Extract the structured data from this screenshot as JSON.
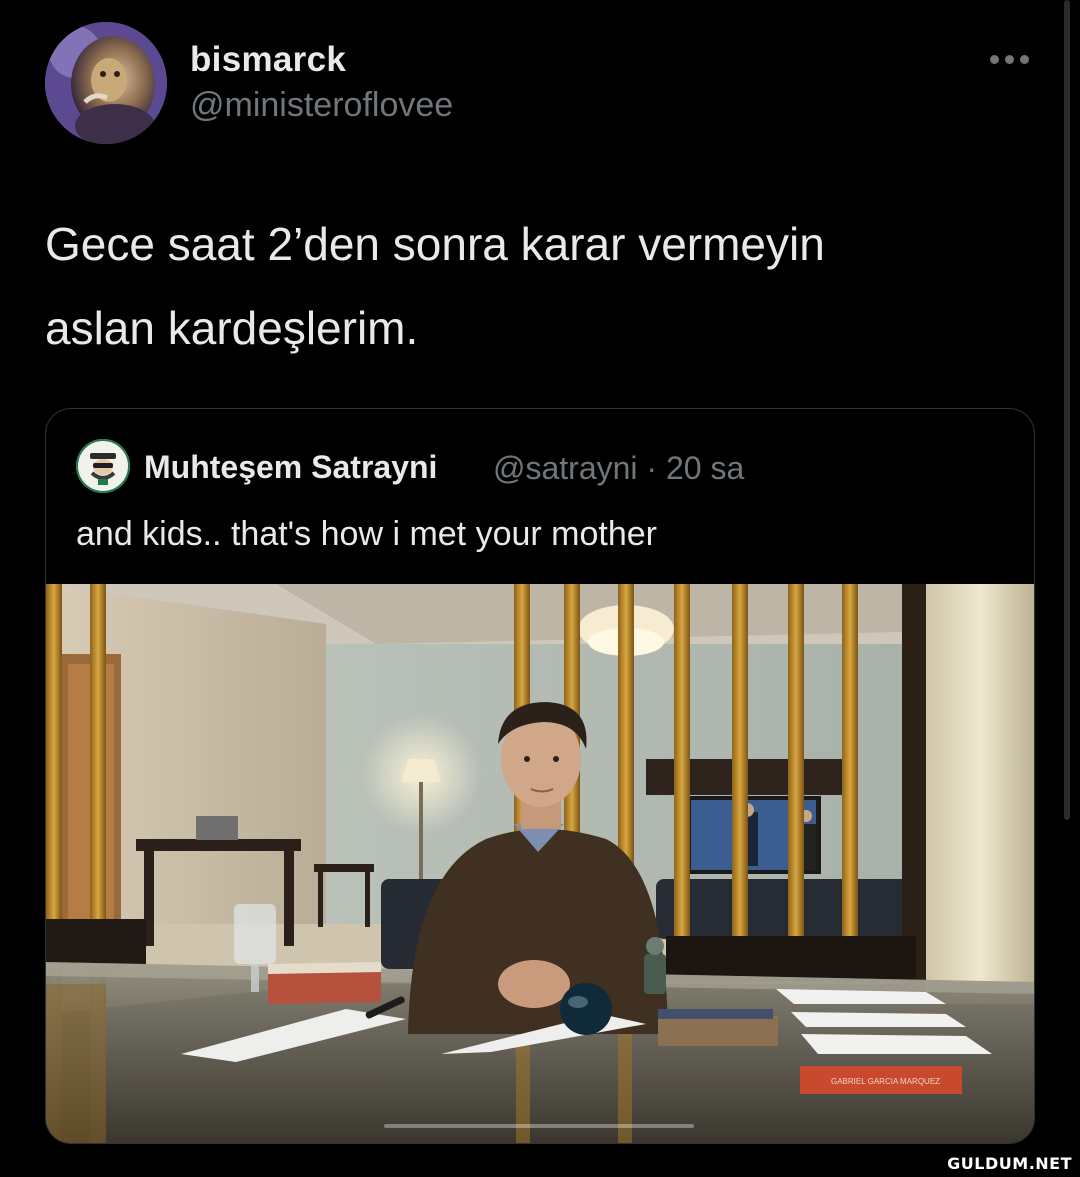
{
  "tweet": {
    "author": {
      "display_name": "bismarck",
      "handle": "@ministeroflovee",
      "avatar": "lion-avatar-icon"
    },
    "more_icon": "more-horizontal-icon",
    "text_lines": [
      "Gece saat 2’den sonra karar vermeyin",
      "aslan kardeşlerim."
    ]
  },
  "quoted_tweet": {
    "author": {
      "display_name": "Muhteşem Satrayni",
      "handle_time": "@satrayni · 20 sa",
      "avatar": "masked-face-avatar-icon"
    },
    "text": "and kids.. that's how i met your mother",
    "media": {
      "tv_screen_color": "#3b5d8f",
      "bamboo_color": "#c8962e",
      "book_spine_text": "GABRIEL GARCIA MARQUEZ"
    }
  },
  "watermark": "GULDUM.NET",
  "colors": {
    "background": "#000000",
    "primary_text": "#e7e9ea",
    "secondary_text": "#71767b",
    "border": "#2f3336"
  }
}
